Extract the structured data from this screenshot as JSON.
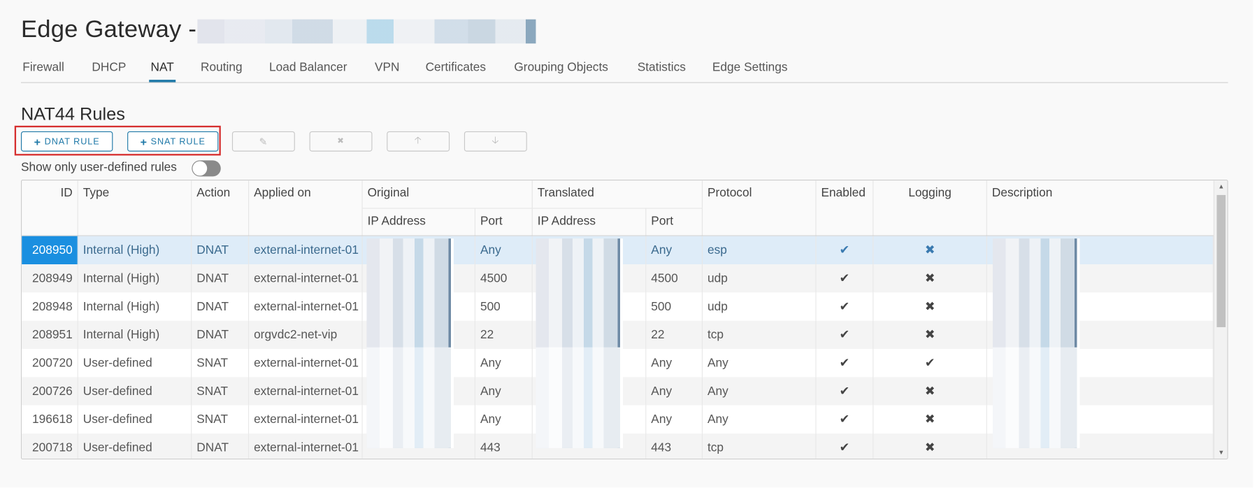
{
  "header": {
    "title": "Edge Gateway -"
  },
  "tabs": [
    {
      "label": "Firewall"
    },
    {
      "label": "DHCP"
    },
    {
      "label": "NAT",
      "active": true
    },
    {
      "label": "Routing"
    },
    {
      "label": "Load Balancer"
    },
    {
      "label": "VPN"
    },
    {
      "label": "Certificates"
    },
    {
      "label": "Grouping Objects"
    },
    {
      "label": "Statistics"
    },
    {
      "label": "Edge Settings"
    }
  ],
  "section": {
    "title": "NAT44 Rules"
  },
  "toolbar": {
    "dnat_label": "DNAT RULE",
    "snat_label": "SNAT RULE",
    "plus_icon": "+",
    "edit_icon": "✎",
    "delete_icon": "✖",
    "up_icon": "🡡",
    "down_icon": "🡣"
  },
  "filter": {
    "label": "Show only user-defined rules",
    "enabled": false
  },
  "table": {
    "headers": {
      "id": "ID",
      "type": "Type",
      "action": "Action",
      "applied_on": "Applied on",
      "original": "Original",
      "translated": "Translated",
      "ip_address": "IP Address",
      "port": "Port",
      "protocol": "Protocol",
      "enabled": "Enabled",
      "logging": "Logging",
      "description": "Description"
    },
    "rows": [
      {
        "id": "208950",
        "type": "Internal (High)",
        "action": "DNAT",
        "applied_on": "external-internet-01",
        "orig_port": "Any",
        "trans_port": "Any",
        "protocol": "esp",
        "enabled": "✔",
        "logging": "✖",
        "selected": true
      },
      {
        "id": "208949",
        "type": "Internal (High)",
        "action": "DNAT",
        "applied_on": "external-internet-01",
        "orig_port": "4500",
        "trans_port": "4500",
        "protocol": "udp",
        "enabled": "✔",
        "logging": "✖"
      },
      {
        "id": "208948",
        "type": "Internal (High)",
        "action": "DNAT",
        "applied_on": "external-internet-01",
        "orig_port": "500",
        "trans_port": "500",
        "protocol": "udp",
        "enabled": "✔",
        "logging": "✖"
      },
      {
        "id": "208951",
        "type": "Internal (High)",
        "action": "DNAT",
        "applied_on": "orgvdc2-net-vip",
        "orig_port": "22",
        "trans_port": "22",
        "protocol": "tcp",
        "enabled": "✔",
        "logging": "✖"
      },
      {
        "id": "200720",
        "type": "User-defined",
        "action": "SNAT",
        "applied_on": "external-internet-01",
        "orig_port": "Any",
        "trans_port": "Any",
        "protocol": "Any",
        "enabled": "✔",
        "logging": "✔"
      },
      {
        "id": "200726",
        "type": "User-defined",
        "action": "SNAT",
        "applied_on": "external-internet-01",
        "orig_port": "Any",
        "trans_port": "Any",
        "protocol": "Any",
        "enabled": "✔",
        "logging": "✖"
      },
      {
        "id": "196618",
        "type": "User-defined",
        "action": "SNAT",
        "applied_on": "external-internet-01",
        "orig_port": "Any",
        "trans_port": "Any",
        "protocol": "Any",
        "enabled": "✔",
        "logging": "✖"
      },
      {
        "id": "200718",
        "type": "User-defined",
        "action": "DNAT",
        "applied_on": "external-internet-01",
        "orig_port": "443",
        "trans_port": "443",
        "protocol": "tcp",
        "enabled": "✔",
        "logging": "✖"
      }
    ]
  },
  "colors": {
    "accent": "#1f79a8",
    "selected_row": "#deecf8",
    "selected_id": "#1a8fe0",
    "highlight_box": "#d62f2f"
  }
}
